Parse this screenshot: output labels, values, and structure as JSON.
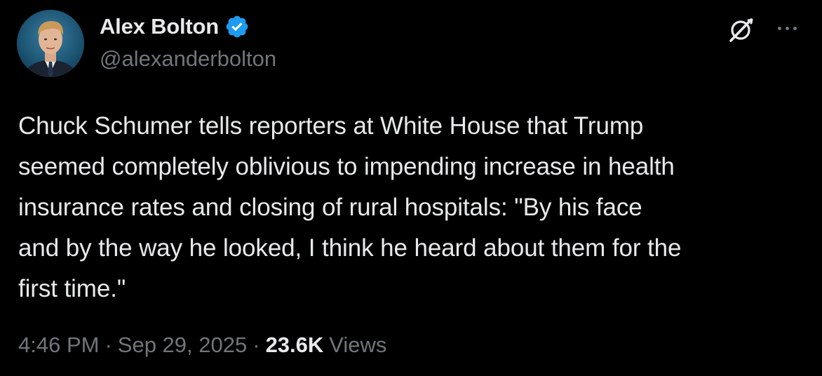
{
  "author": {
    "display_name": "Alex Bolton",
    "handle": "@alexanderbolton",
    "verified_badge": "verified-badge-icon",
    "badge_color": "#1d9bf0"
  },
  "header_actions": {
    "grok_icon": "grok-icon",
    "more_icon": "more-options-icon"
  },
  "tweet": {
    "lines": [
      "Chuck Schumer tells reporters at White House that Trump",
      "seemed completely oblivious to impending increase in health",
      "insurance rates and closing of rural hospitals: \"By his face",
      "and by the way he looked, I think he heard about them for the",
      "first time.\""
    ]
  },
  "meta": {
    "time": "4:46 PM",
    "separator": "·",
    "date": "Sep 29, 2025",
    "views_count": "23.6K",
    "views_label": "Views"
  },
  "colors": {
    "background": "#000000",
    "primary_text": "#e7e9ea",
    "secondary_text": "#71767b"
  }
}
